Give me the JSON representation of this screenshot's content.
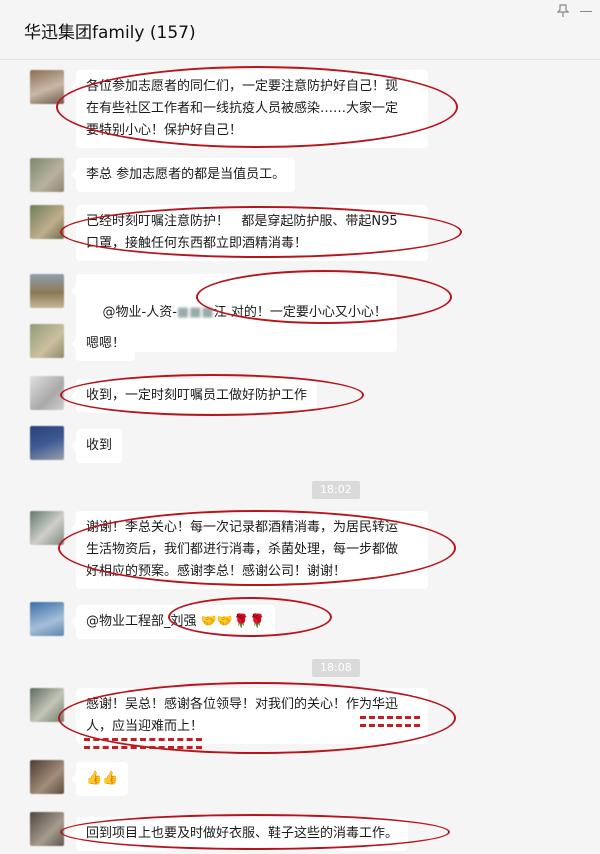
{
  "header": {
    "title": "华迅集团family (157)",
    "pin_icon": "pin-icon",
    "minimize_icon": "minimize-icon"
  },
  "messages": [
    {
      "text": "各位参加志愿者的同仁们，一定要注意防护好自己！现\n在有些社区工作者和一线抗疫人员被感染……大家一定\n要特别小心！保护好自己！",
      "avatar_colors": [
        "#8a6e55",
        "#c9b8a6"
      ]
    },
    {
      "text": "李总 参加志愿者的都是当值员工。",
      "avatar_colors": [
        "#7c8a6a",
        "#b9b1a0"
      ]
    },
    {
      "text": "已经时刻叮嘱注意防护！   都是穿起防护服、带起N95\n口罩，接触任何东西都立即酒精消毒！",
      "avatar_colors": [
        "#6f7f5a",
        "#bfae8c"
      ]
    },
    {
      "text_before": "@物业-人资-",
      "text_redacted": "■■■",
      "text_after": "江 对的！一定要小心又小心！",
      "avatar_colors": [
        "#8a7a55",
        "#c6b59a"
      ]
    },
    {
      "text": "嗯嗯！",
      "avatar_colors": [
        "#909a78",
        "#ccc0a0"
      ]
    },
    {
      "text": "收到，一定时刻叮嘱员工做好防护工作",
      "avatar_colors": [
        "#e0e0e0",
        "#a9a9a9"
      ]
    },
    {
      "text": "收到",
      "avatar_colors": [
        "#27407a",
        "#9a9fb0"
      ]
    },
    {
      "text": "谢谢！李总关心！每一次记录都酒精消毒，为居民转运\n生活物资后，我们都进行消毒，杀菌处理，每一步都做\n好相应的预案。感谢李总！感谢公司！谢谢！",
      "avatar_colors": [
        "#5f7a6a",
        "#cfcfc8"
      ]
    },
    {
      "text": "@物业工程部_刘强 🤝🤝🌹🌹",
      "avatar_colors": [
        "#3b6ea8",
        "#a5bfd8"
      ]
    },
    {
      "text": "感谢！吴总！感谢各位领导！对我们的关心！作为华迅\n人，应当迎难而上！",
      "avatar_colors": [
        "#5a6e60",
        "#c4c4b8"
      ]
    },
    {
      "text": "👍👍",
      "avatar_colors": [
        "#4a3c33",
        "#a38d7a"
      ]
    },
    {
      "text": "回到项目上也要及时做好衣服、鞋子这些的消毒工作。",
      "avatar_colors": [
        "#4f4640",
        "#a89c90"
      ]
    }
  ],
  "timestamps": [
    "18:02",
    "18:08"
  ]
}
